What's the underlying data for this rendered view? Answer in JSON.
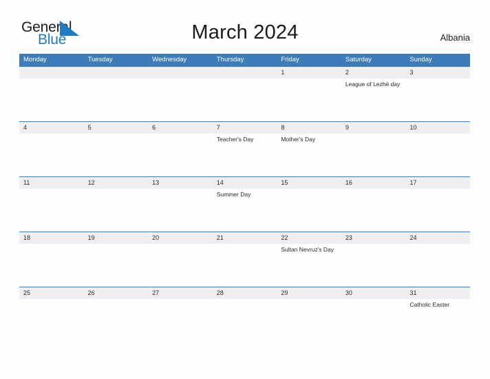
{
  "header": {
    "logo": {
      "text_primary": "General",
      "text_secondary": "Blue",
      "icon": "flag-triangle-icon",
      "color_primary": "#1b1b1b",
      "color_secondary": "#1f7bc4"
    },
    "title": "March 2024",
    "country": "Albania"
  },
  "calendar": {
    "accent_color": "#3d7cb8",
    "date_strip_color": "#efefef",
    "weekdays": [
      "Monday",
      "Tuesday",
      "Wednesday",
      "Thursday",
      "Friday",
      "Saturday",
      "Sunday"
    ],
    "weeks": [
      {
        "dates": [
          "",
          "",
          "",
          "",
          "1",
          "2",
          "3"
        ],
        "events": [
          "",
          "",
          "",
          "",
          "",
          "League of Lezhë day",
          ""
        ]
      },
      {
        "dates": [
          "4",
          "5",
          "6",
          "7",
          "8",
          "9",
          "10"
        ],
        "events": [
          "",
          "",
          "",
          "Teacher's Day",
          "Mother's Day",
          "",
          ""
        ]
      },
      {
        "dates": [
          "11",
          "12",
          "13",
          "14",
          "15",
          "16",
          "17"
        ],
        "events": [
          "",
          "",
          "",
          "Summer Day",
          "",
          "",
          ""
        ]
      },
      {
        "dates": [
          "18",
          "19",
          "20",
          "21",
          "22",
          "23",
          "24"
        ],
        "events": [
          "",
          "",
          "",
          "",
          "Sultan Nevruz's Day",
          "",
          ""
        ]
      },
      {
        "dates": [
          "25",
          "26",
          "27",
          "28",
          "29",
          "30",
          "31"
        ],
        "events": [
          "",
          "",
          "",
          "",
          "",
          "",
          "Catholic Easter"
        ]
      }
    ]
  }
}
